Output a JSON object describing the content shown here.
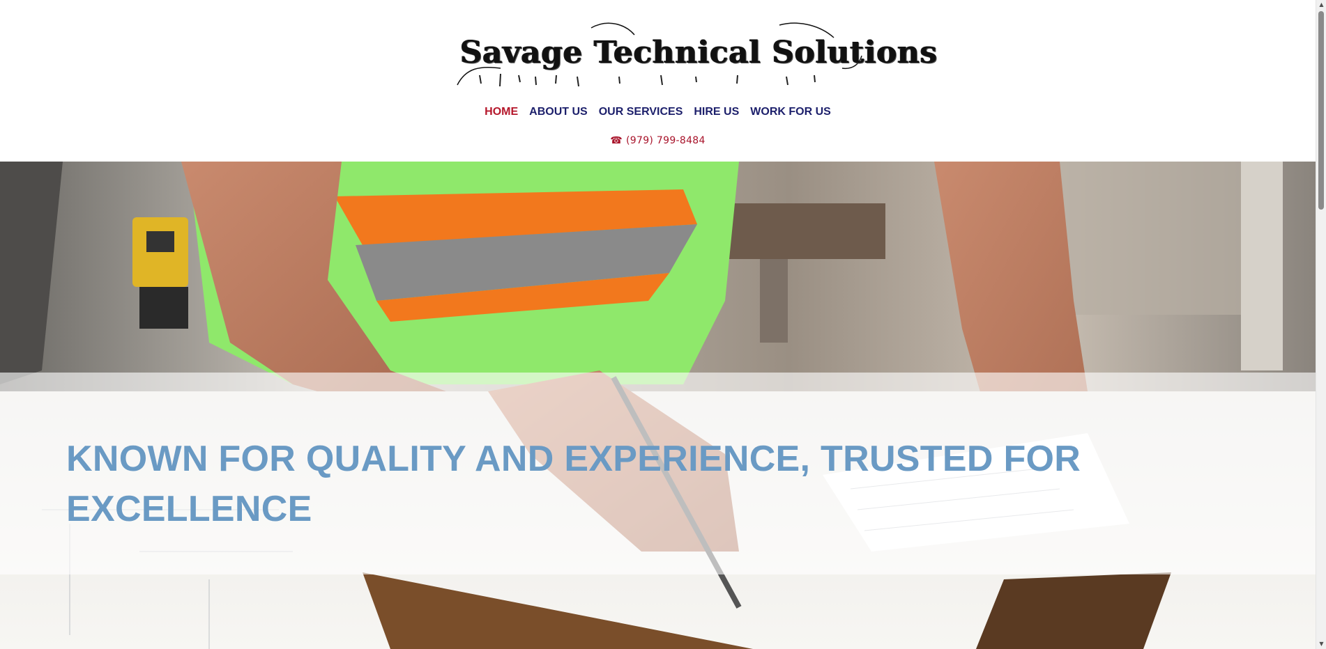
{
  "site": {
    "logo_text": "Savage Technical Solutions"
  },
  "nav": {
    "items": [
      {
        "label": "HOME",
        "active": true
      },
      {
        "label": "ABOUT US",
        "active": false
      },
      {
        "label": "OUR SERVICES",
        "active": false
      },
      {
        "label": "HIRE US",
        "active": false
      },
      {
        "label": "WORK FOR US",
        "active": false
      }
    ]
  },
  "contact": {
    "phone": "(979) 799-8484",
    "phone_icon": "telephone-icon"
  },
  "hero": {
    "headline": "KNOWN FOR QUALITY AND EXPERIENCE, TRUSTED FOR EXCELLENCE",
    "image": "worker-in-safety-vest-writing-on-clipboard"
  },
  "colors": {
    "nav_text": "#1c1f6b",
    "nav_active": "#b5172b",
    "phone_text": "#a8132a",
    "headline": "#6a9ac4"
  }
}
